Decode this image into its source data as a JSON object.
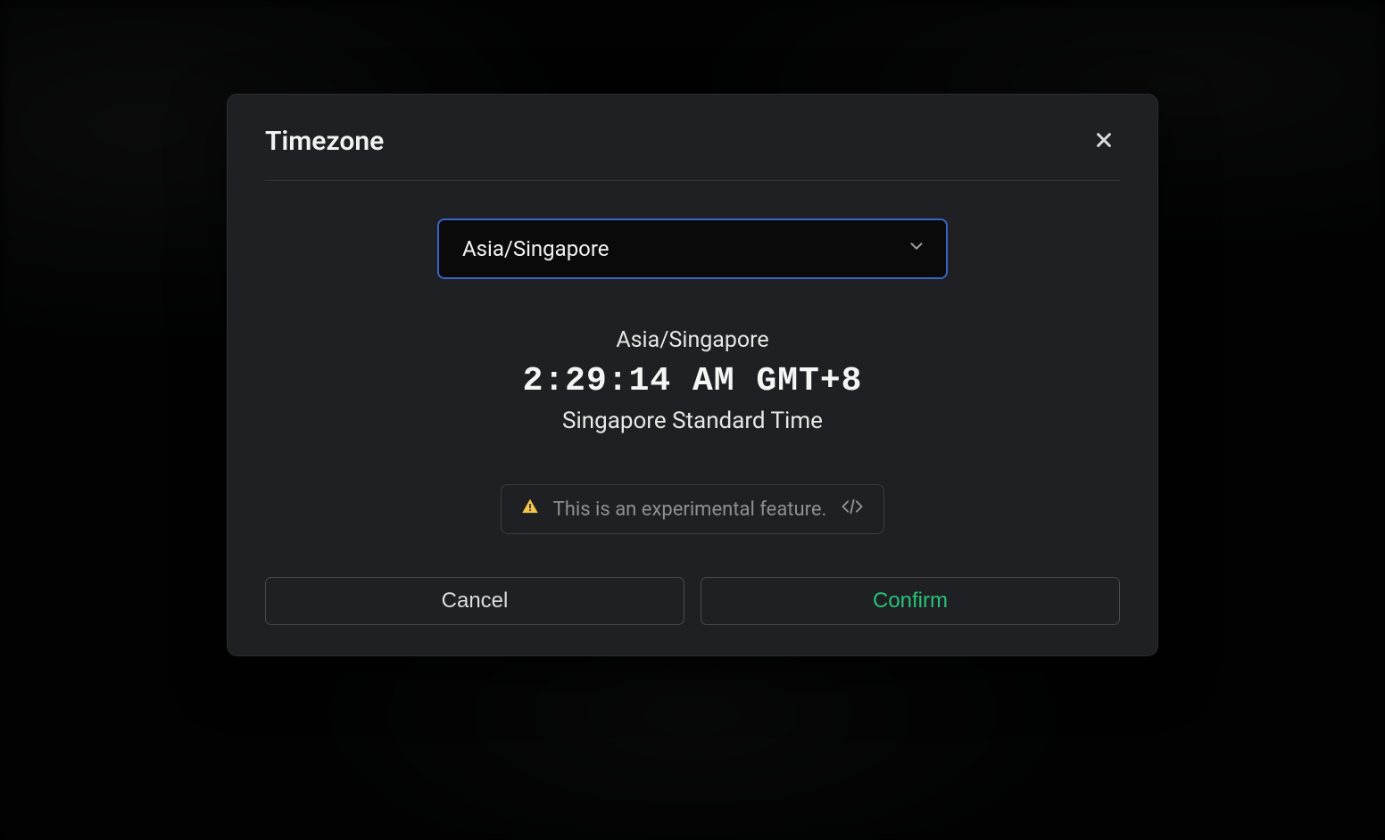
{
  "modal": {
    "title": "Timezone",
    "select": {
      "value": "Asia/Singapore"
    },
    "preview": {
      "tz_id": "Asia/Singapore",
      "time": "2:29:14 AM GMT+8",
      "tz_long": "Singapore Standard Time"
    },
    "experimental_notice": "This is an experimental feature.",
    "buttons": {
      "cancel": "Cancel",
      "confirm": "Confirm"
    }
  },
  "icons": {
    "close": "close-icon",
    "chevron_down": "chevron-down-icon",
    "warning": "warning-triangle-icon",
    "code": "code-icon"
  },
  "colors": {
    "modal_bg": "#1f2023",
    "select_border": "#3b64c4",
    "confirm_text": "#28c179",
    "warning": "#f3c54b"
  }
}
